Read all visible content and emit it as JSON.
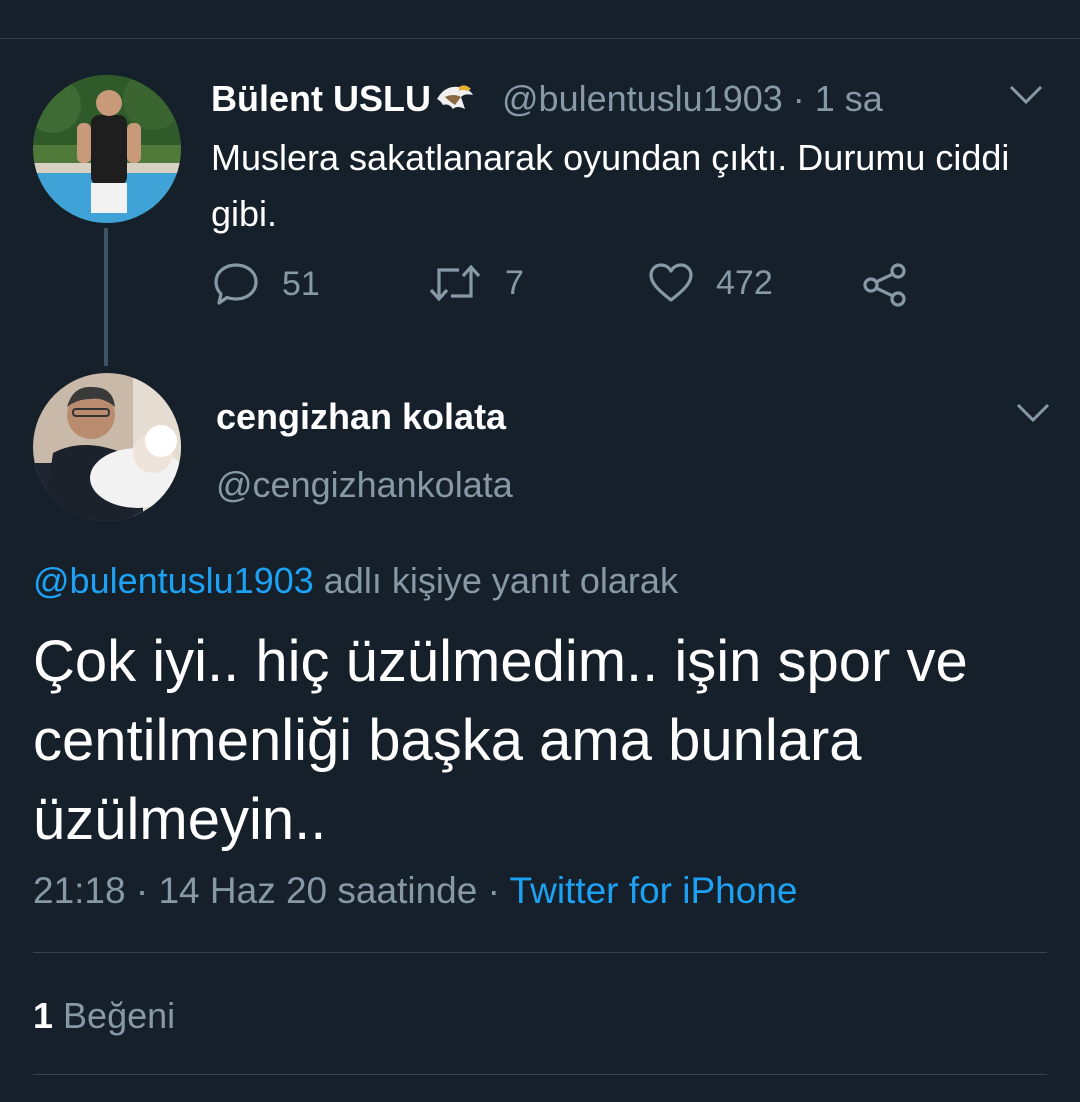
{
  "tweet": {
    "author": {
      "name": "Bülent USLU",
      "badge_icon": "eagle-icon",
      "handle": "@bulentuslu1903",
      "time": "1 sa"
    },
    "text": "Muslera sakatlanarak oyundan çıktı. Durumu ciddi gibi.",
    "actions": {
      "reply_count": "51",
      "retweet_count": "7",
      "like_count": "472"
    }
  },
  "reply": {
    "author": {
      "name": "cengizhan kolata",
      "handle": "@cengizhankolata"
    },
    "replying_to": {
      "handle": "@bulentuslu1903",
      "suffix": "adlı kişiye yanıt olarak"
    },
    "text": "Çok iyi.. hiç üzülmedim.. işin spor ve centilmenliği başka ama bunlara üzülmeyin..",
    "meta": {
      "timestamp": "21:18 · 14 Haz 20 saatinde",
      "separator": "·",
      "source": "Twitter for iPhone"
    },
    "likes": {
      "count": "1",
      "label": "Beğeni"
    }
  },
  "colors": {
    "background": "#15202b",
    "muted_text": "#8899a6",
    "link": "#1da1f2",
    "divider": "#38444d"
  }
}
